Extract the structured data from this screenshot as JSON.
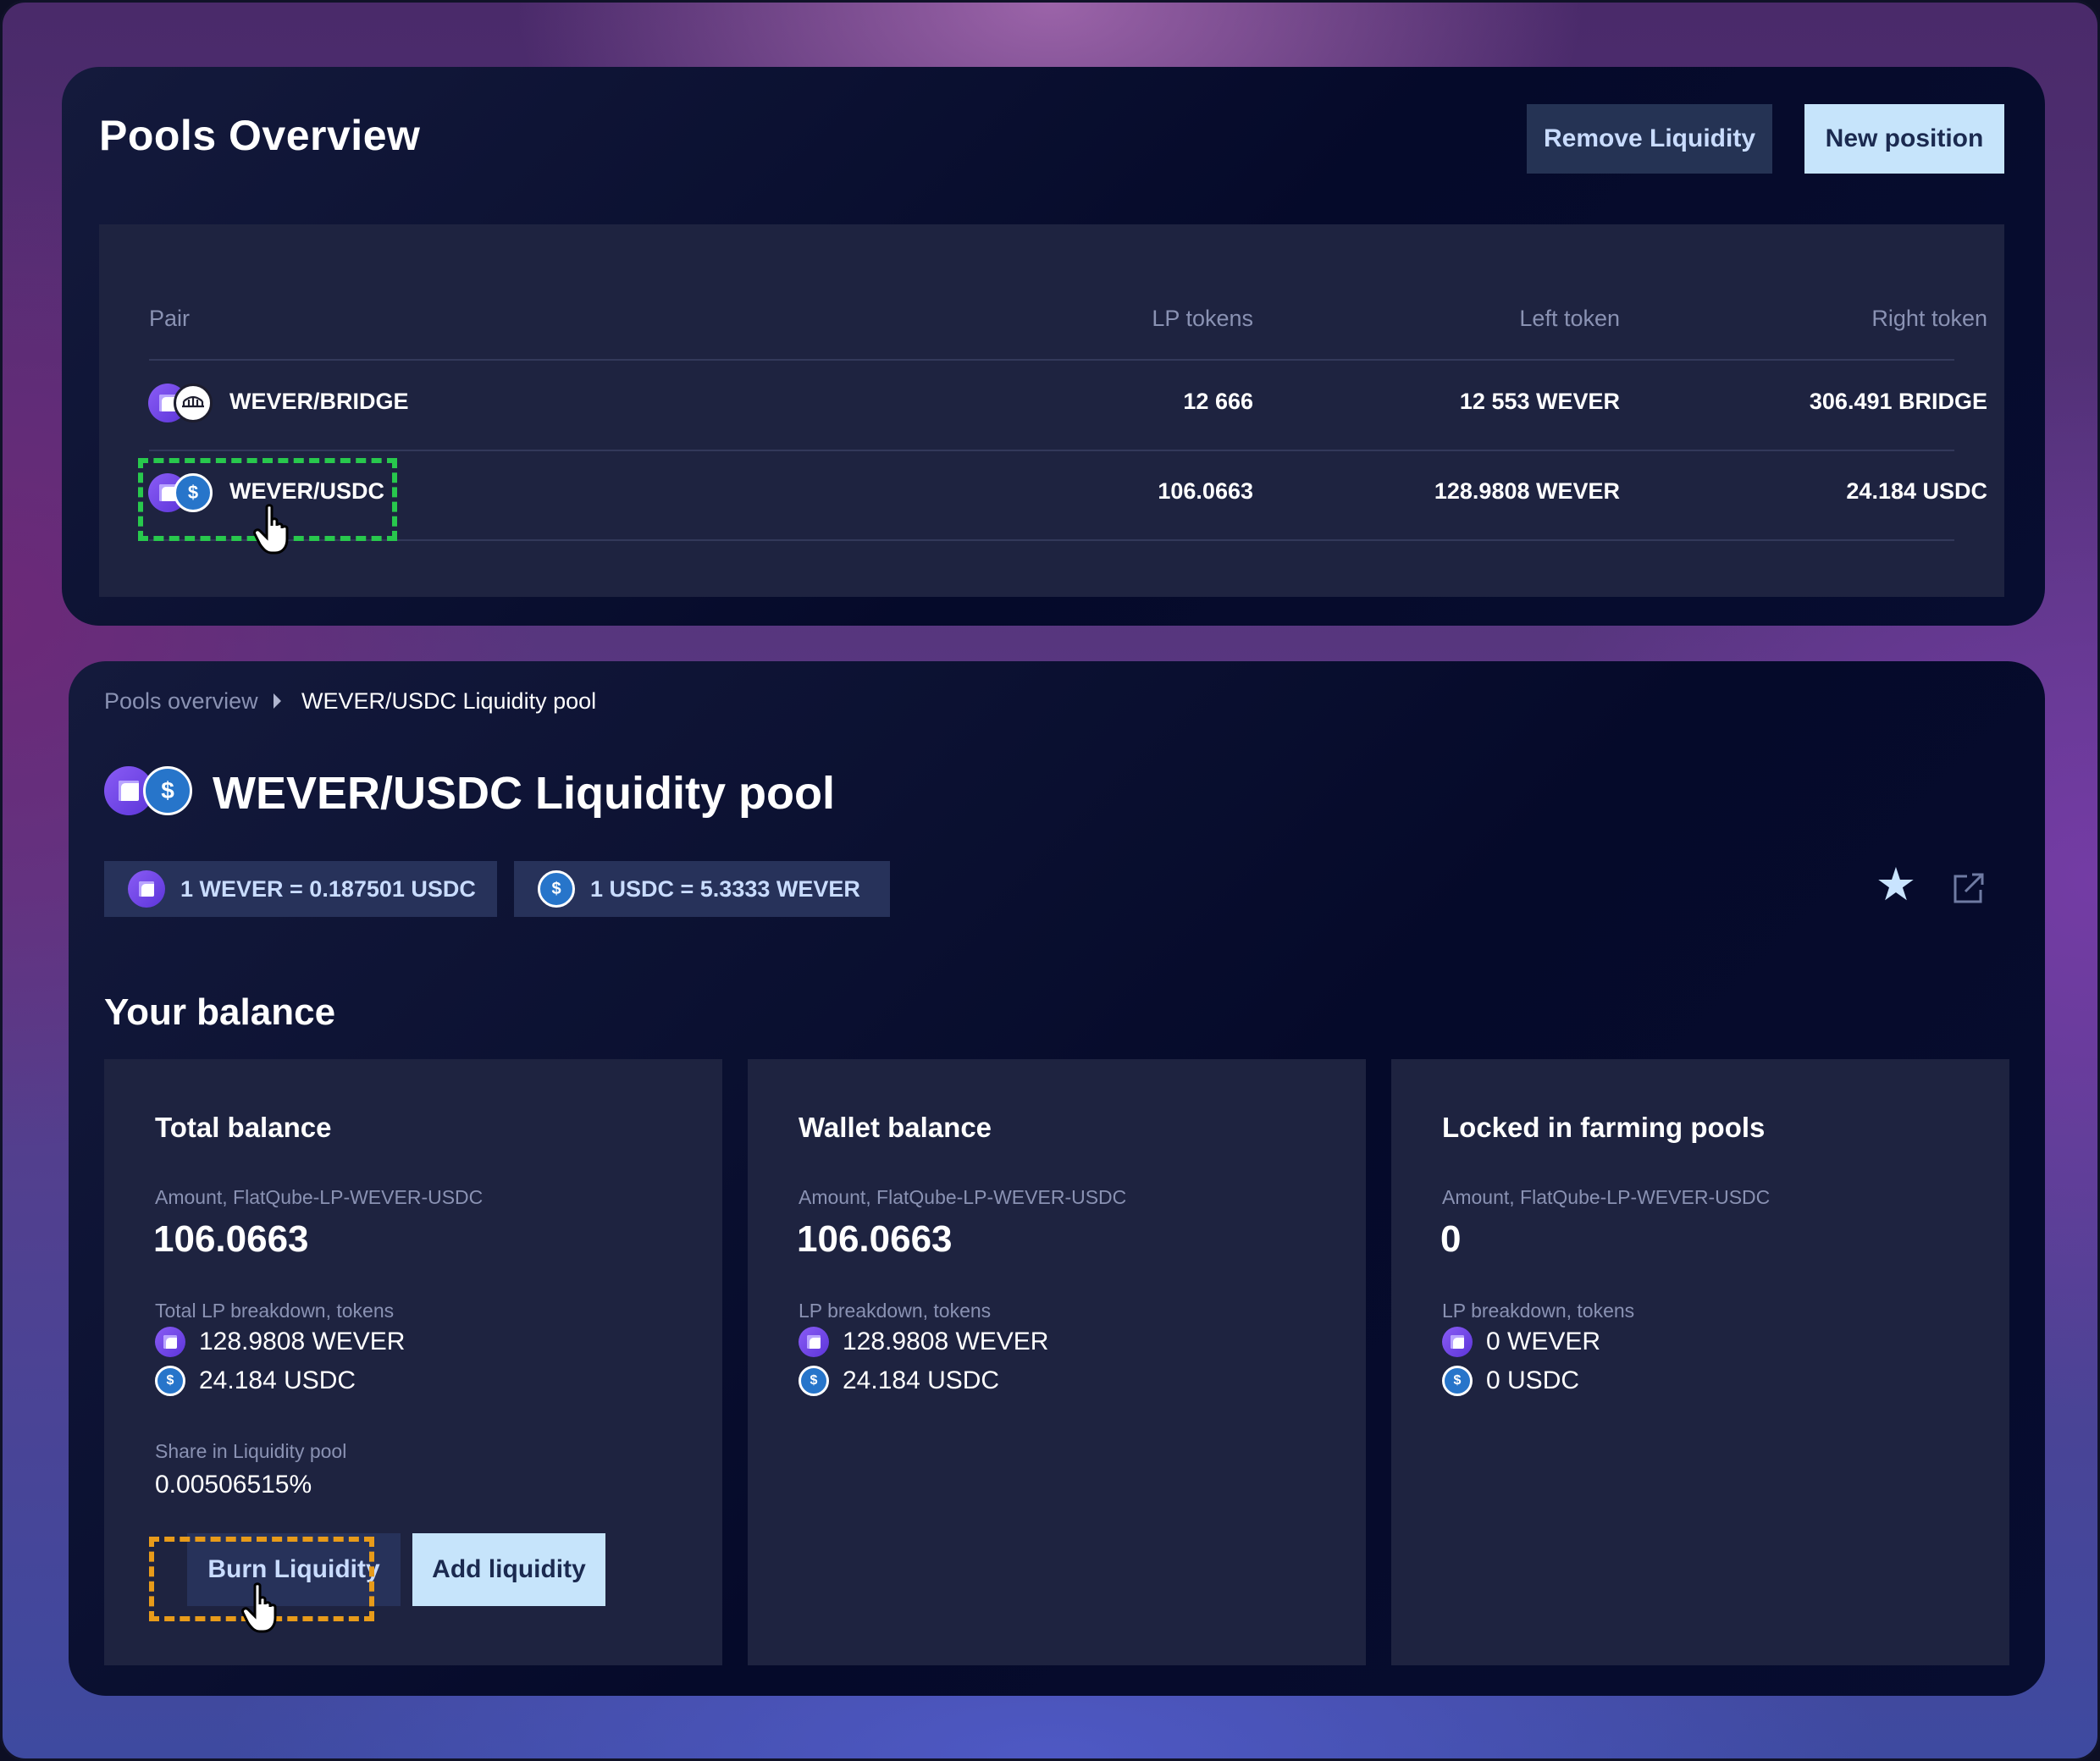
{
  "overview": {
    "title": "Pools Overview",
    "remove_label": "Remove Liquidity",
    "new_label": "New position",
    "columns": [
      "Pair",
      "LP tokens",
      "Left token",
      "Right token"
    ],
    "rows": [
      {
        "pair": "WEVER/BRIDGE",
        "lp": "12 666",
        "left": "12 553 WEVER",
        "right": "306.491 BRIDGE",
        "icons": [
          "wever-icon",
          "bridge-icon"
        ]
      },
      {
        "pair": "WEVER/USDC",
        "lp": "106.0663",
        "left": "128.9808 WEVER",
        "right": "24.184 USDC",
        "icons": [
          "wever-icon",
          "usdc-icon"
        ]
      }
    ]
  },
  "breadcrumb": {
    "parent": "Pools overview",
    "current": "WEVER/USDC Liquidity pool"
  },
  "pool": {
    "title": "WEVER/USDC Liquidity pool",
    "rate_1": "1 WEVER = 0.187501 USDC",
    "rate_2": "1 USDC = 5.3333 WEVER"
  },
  "balance": {
    "section_title": "Your balance",
    "total": {
      "title": "Total balance",
      "amount_label": "Amount, FlatQube-LP-WEVER-USDC",
      "amount": "106.0663",
      "breakdown_label": "Total LP breakdown, tokens",
      "wever": "128.9808 WEVER",
      "usdc": "24.184 USDC",
      "share_label": "Share in Liquidity pool",
      "share": "0.00506515%",
      "burn_label": "Burn Liquidity",
      "add_label": "Add liquidity"
    },
    "wallet": {
      "title": "Wallet balance",
      "amount_label": "Amount, FlatQube-LP-WEVER-USDC",
      "amount": "106.0663",
      "breakdown_label": "LP breakdown, tokens",
      "wever": "128.9808 WEVER",
      "usdc": "24.184 USDC"
    },
    "locked": {
      "title": "Locked in farming pools",
      "amount_label": "Amount, FlatQube-LP-WEVER-USDC",
      "amount": "0",
      "breakdown_label": "LP breakdown, tokens",
      "wever": "0 WEVER",
      "usdc": "0 USDC"
    }
  },
  "colors": {
    "accent_button": "#c6e4fb",
    "secondary_button": "#253354",
    "highlight_green": "#28c84d",
    "highlight_orange": "#e89b1a"
  }
}
